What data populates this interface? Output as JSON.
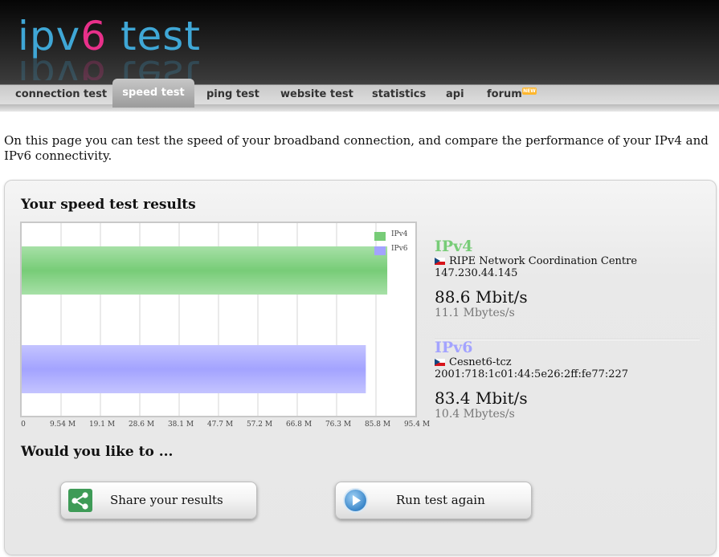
{
  "header": {
    "logo_part1": "ipv",
    "logo_part2": "6",
    "logo_part3": " test"
  },
  "nav": {
    "tabs": [
      {
        "label": "connection test"
      },
      {
        "label": "speed test",
        "active": true
      },
      {
        "label": "ping test"
      },
      {
        "label": "website test"
      },
      {
        "label": "statistics"
      },
      {
        "label": "api"
      },
      {
        "label": "forum",
        "badge": "NEW"
      }
    ]
  },
  "intro": "On this page you can test the speed of your broadband connection, and compare the performance of your IPv4 and IPv6 connectivity.",
  "results": {
    "heading": "Your speed test results",
    "ipv4": {
      "title": "IPv4",
      "isp": "RIPE Network Coordination Centre",
      "ip": "147.230.44.145",
      "mbit": "88.6 Mbit/s",
      "mbyte": "11.1 Mbytes/s",
      "color": "#77cc77",
      "flag": "czech-flag-icon"
    },
    "ipv6": {
      "title": "IPv6",
      "isp": "Cesnet6-tcz",
      "ip": "2001:718:1c01:44:5e26:2ff:fe77:227",
      "mbit": "83.4 Mbit/s",
      "mbyte": "10.4 Mbytes/s",
      "color": "#a3a3ff",
      "flag": "czech-flag-icon"
    }
  },
  "chart_data": {
    "type": "bar",
    "orientation": "horizontal",
    "categories": [
      "IPv4",
      "IPv6"
    ],
    "series": [
      {
        "name": "IPv4",
        "values": [
          88.6
        ],
        "color": "#77cc77"
      },
      {
        "name": "IPv6",
        "values": [
          83.4
        ],
        "color": "#a3a3ff"
      }
    ],
    "xticks": [
      "0",
      "9.54 M",
      "19.1 M",
      "28.6 M",
      "38.1 M",
      "47.7 M",
      "57.2 M",
      "66.8 M",
      "76.3 M",
      "85.8 M",
      "95.4 M"
    ],
    "xlim": [
      0,
      95.4
    ],
    "grid": true,
    "legend_position": "top-right"
  },
  "followup": {
    "heading": "Would you like to ...",
    "share_label": "Share your results",
    "share_icon": "share-icon",
    "run_label": "Run test again",
    "run_icon": "play-icon"
  }
}
